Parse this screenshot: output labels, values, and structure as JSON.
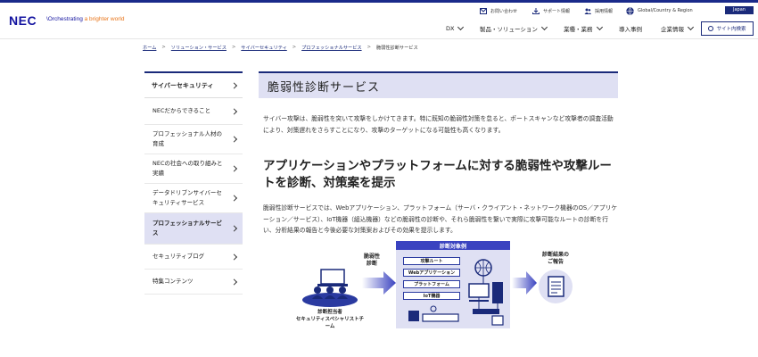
{
  "header": {
    "logo": "NEC",
    "tagline_prefix": "\\Orchestrating ",
    "tagline_accent": "a brighter world",
    "util": {
      "contact": "お問い合わせ",
      "support": "サポート情報",
      "careers": "採用情報",
      "global": "Global/Country & Region",
      "japan": "Japan"
    },
    "nav": {
      "dx": "DX",
      "products": "製品・ソリューション",
      "industry": "業種・業務",
      "cases": "導入事例",
      "corporate": "企業情報",
      "search": "サイト内検索"
    }
  },
  "breadcrumb": [
    "ホーム",
    "ソリューション・サービス",
    "サイバーセキュリティ",
    "プロフェッショナルサービス",
    "脆弱性診断サービス"
  ],
  "sidebar": {
    "heading": "サイバーセキュリティ",
    "items": [
      "NECだからできること",
      "プロフェッショナル人材の育成",
      "NECの社会への取り組みと実績",
      "データドリブンサイバーセキュリティサービス",
      "プロフェッショナルサービス",
      "セキュリティブログ",
      "特集コンテンツ"
    ]
  },
  "main": {
    "title": "脆弱性診断サービス",
    "intro": "サイバー攻撃は、脆弱性を突いて攻撃をしかけてきます。特に既知の脆弱性対策を怠ると、ポートスキャンなど攻撃者の調査活動により、対策遅れをさらすことになり、攻撃のターゲットになる可能性も高くなります。",
    "heading": "アプリケーションやプラットフォームに対する脆弱性や攻撃ルートを診断、対策案を提示",
    "body": "脆弱性診断サービスでは、Webアプリケーション、プラットフォーム（サーバ・クライアント・ネットワーク機器のOS／アプリケーション／サービス）、IoT機器（組込機器）などの脆弱性の診断や、それら脆弱性を繋いで実際に攻撃可能なルートの診断を行い、分析結果の報告と今後必要な対策案およびその効果を提示します。"
  },
  "diagram": {
    "left_label_1": "脆弱性",
    "left_label_2": "診断",
    "team_1": "診断担当者",
    "team_2": "セキュリティスペシャリストチーム",
    "target_title": "診断対象例",
    "targets": [
      "攻撃ルート",
      "Webアプリケーション",
      "プラットフォーム",
      "IoT機器"
    ],
    "result_1": "診断結果の",
    "result_2": "ご報告"
  },
  "colors": {
    "brand": "#1414a0",
    "navy": "#1a2a7a",
    "accent": "#e8751a",
    "highlight": "#dfe0f3",
    "diagram_blue": "#3a43c0"
  }
}
